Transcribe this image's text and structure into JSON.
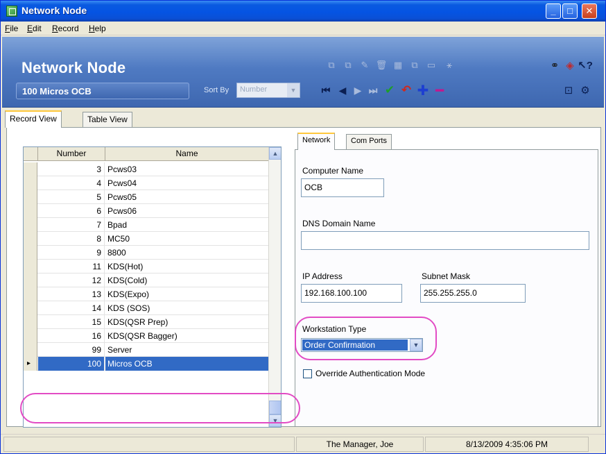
{
  "window": {
    "title": "Network Node"
  },
  "menu": [
    "File",
    "Edit",
    "Record",
    "Help"
  ],
  "header": {
    "module_title": "Network Node",
    "current_record": "100 Micros OCB",
    "sort_by_label": "Sort By",
    "sort_by_value": "Number"
  },
  "tabs": [
    "Record View",
    "Table View"
  ],
  "grid": {
    "columns": [
      "Number",
      "Name"
    ],
    "rows": [
      {
        "number": "3",
        "name": "Pcws03"
      },
      {
        "number": "4",
        "name": "Pcws04"
      },
      {
        "number": "5",
        "name": "Pcws05"
      },
      {
        "number": "6",
        "name": "Pcws06"
      },
      {
        "number": "7",
        "name": "Bpad"
      },
      {
        "number": "8",
        "name": "MC50"
      },
      {
        "number": "9",
        "name": "8800"
      },
      {
        "number": "11",
        "name": "KDS(Hot)"
      },
      {
        "number": "12",
        "name": "KDS(Cold)"
      },
      {
        "number": "13",
        "name": "KDS(Expo)"
      },
      {
        "number": "14",
        "name": "KDS (SOS)"
      },
      {
        "number": "15",
        "name": "KDS(QSR Prep)"
      },
      {
        "number": "16",
        "name": "KDS(QSR Bagger)"
      },
      {
        "number": "99",
        "name": "Server"
      },
      {
        "number": "100",
        "name": "Micros OCB"
      }
    ],
    "selected_index": 14
  },
  "detail_tabs": [
    "Network",
    "Com Ports"
  ],
  "form": {
    "computer_name_label": "Computer Name",
    "computer_name_value": "OCB",
    "dns_label": "DNS Domain Name",
    "dns_value": "",
    "ip_label": "IP Address",
    "ip_value": "192.168.100.100",
    "subnet_label": "Subnet Mask",
    "subnet_value": "255.255.255.0",
    "workstation_type_label": "Workstation Type",
    "workstation_type_value": "Order Confirmation",
    "override_auth_label": "Override Authentication Mode",
    "override_auth_checked": false
  },
  "status": {
    "user": "The Manager, Joe",
    "datetime": "8/13/2009 4:35:06 PM"
  },
  "colors": {
    "selection": "#316ac5",
    "highlight_ring": "#e24bc4",
    "header_band": "#4f7ac2"
  }
}
